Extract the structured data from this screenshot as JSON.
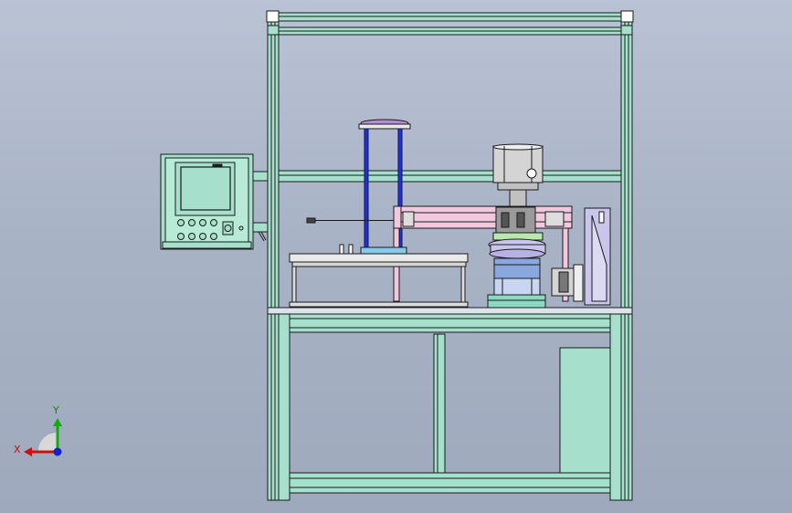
{
  "view": {
    "triad": {
      "x_label": "X",
      "y_label": "Y"
    }
  },
  "colors": {
    "frame": "#a6e0cc",
    "frame_dark": "#7fbba7",
    "outline": "#1a1a1a",
    "pink": "#f2c8df",
    "blue_rod": "#2233cc",
    "lavender": "#c9c5ec",
    "grey_metal": "#c9c9c9",
    "axis_x": "#cc1111",
    "axis_y": "#11aa11",
    "axis_z": "#1122cc"
  },
  "icons": {
    "triad": "coordinate-triad-icon",
    "panel": "control-panel-icon"
  }
}
